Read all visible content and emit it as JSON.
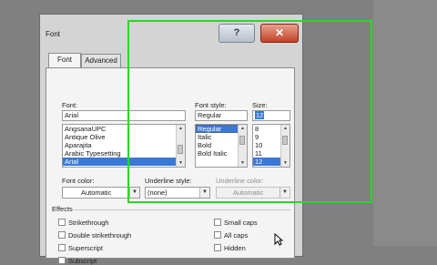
{
  "dialog": {
    "title": "Font",
    "help_label": "?",
    "close_label": "✕"
  },
  "tabs": [
    {
      "label": "Font",
      "active": true
    },
    {
      "label": "Advanced",
      "active": false
    }
  ],
  "font": {
    "label": "Font:",
    "value": "Arial",
    "items": [
      "AngsanaUPC",
      "Antique Olive",
      "Aparajita",
      "Arabic Typesetting",
      "Arial"
    ],
    "selected": "Arial"
  },
  "font_style": {
    "label": "Font style:",
    "value": "Regular",
    "items": [
      "Regular",
      "Italic",
      "Bold",
      "Bold Italic"
    ],
    "selected": "Regular"
  },
  "size": {
    "label": "Size:",
    "value": "12",
    "items": [
      "8",
      "9",
      "10",
      "11",
      "12"
    ],
    "selected": "12"
  },
  "font_color": {
    "label": "Font color:",
    "value": "Automatic"
  },
  "underline_style": {
    "label": "Underline style:",
    "value": "(none)"
  },
  "underline_color": {
    "label": "Underline color:",
    "value": "Automatic"
  },
  "effects": {
    "label": "Effects",
    "left": [
      "Strikethrough",
      "Double strikethrough",
      "Superscript",
      "Subscript"
    ],
    "right": [
      "Small caps",
      "All caps",
      "Hidden"
    ]
  },
  "colors": {
    "highlight_box": "#22dd22",
    "selection": "#3a78d8",
    "close": "#c24128"
  },
  "icons": {
    "help": "question-mark-icon",
    "close": "close-icon",
    "cursor": "mouse-pointer-icon"
  }
}
